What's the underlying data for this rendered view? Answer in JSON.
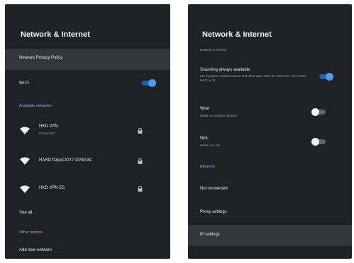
{
  "left_panel": {
    "title": "Network & Internet",
    "privacy_policy": "Network Privacy Policy",
    "wifi_label": "Wi-Fi",
    "wifi_enabled": true,
    "available_networks_header": "Available networks",
    "networks": [
      {
        "name": "HKD VPN",
        "status": "Connected",
        "secured": true
      },
      {
        "name": "HARDTOppC/OT7 DP4G3C",
        "status": "",
        "secured": true
      },
      {
        "name": "HKD VPN 5G",
        "status": "",
        "secured": true
      }
    ],
    "see_all": "See all",
    "other_options_header": "Other options",
    "add_network": "Add new network"
  },
  "right_panel": {
    "title": "Network & Internet",
    "subtitle": "Network & Internet",
    "scanning": {
      "label": "Scanning always available",
      "description": "Let Google's location service and other apps scan for networks, even when Wi-Fi is off",
      "enabled": true
    },
    "wow": {
      "label": "Wow",
      "description": "Wake on wireless network",
      "enabled": false
    },
    "wol": {
      "label": "WoL",
      "description": "Wake on LAN",
      "enabled": false
    },
    "ethernet_header": "Ethernet",
    "not_connected": "Not connected",
    "proxy_settings": "Proxy settings",
    "ip_settings": "IP settings"
  },
  "colors": {
    "panel_bg": "#202124",
    "highlight_bg": "#35363a",
    "accent": "#8ab4f8",
    "toggle_on": "#4a9cff"
  }
}
